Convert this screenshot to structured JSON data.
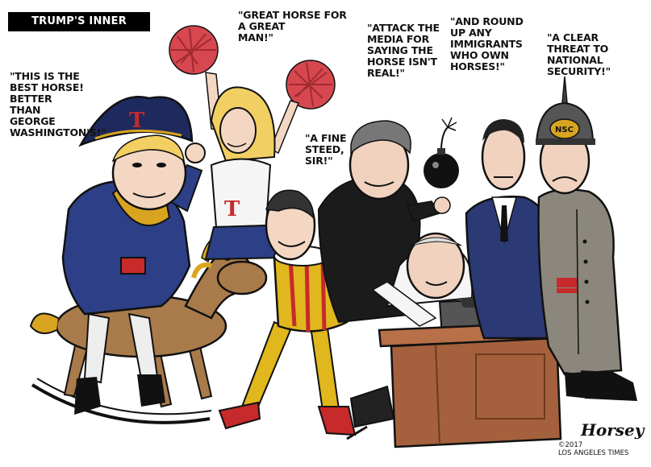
{
  "cartoon": {
    "title": "TRUMP'S INNER CIRCLE:",
    "captions": {
      "trump": "\"THIS IS THE\nBEST HORSE!\nBETTER\nTHAN\nGEORGE\nWASHINGTON'S!\"",
      "cheerleader": "\"GREAT HORSE FOR\nA GREAT\nMAN!\"",
      "courtier": "\"A FINE\nSTEED,\nSIR!\"",
      "bannon": "\"ATTACK THE\nMEDIA FOR\nSAYING THE\nHORSE ISN'T\nREAL!\"",
      "miller": "\"AND ROUND\nUP ANY\nIMMIGRANTS\nWHO OWN\nHORSES!\"",
      "general": "\"A CLEAR\nTHREAT TO\nNATIONAL\nSECURITY!\""
    },
    "hat_letter": "T",
    "shirt_letter": "T",
    "helmet_text": "NSC",
    "signature": "Horsey",
    "copyright_year": "©2017",
    "publisher": "LOS ANGELES TIMES"
  },
  "colors": {
    "ink": "#111111",
    "napoleon_blue": "#2d3f86",
    "red": "#c62a2a",
    "gold": "#d9a520",
    "horse_brown": "#a97b4a",
    "desk_brown": "#a5603d",
    "general_gray": "#8c877c",
    "pom_red": "#d7474f"
  }
}
